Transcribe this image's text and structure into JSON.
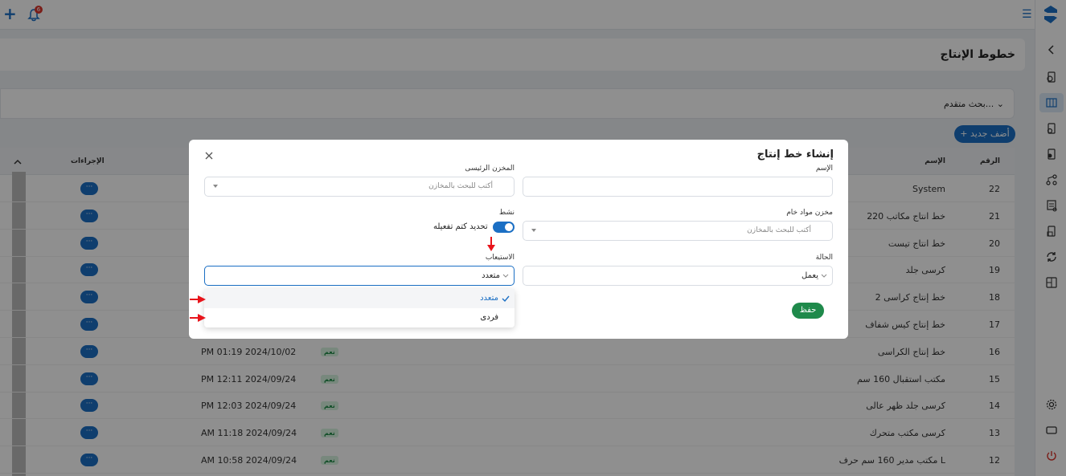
{
  "topbar": {
    "notification_count": "6"
  },
  "page": {
    "title": "خطوط الإنتاج",
    "search_toggle": "بحث متقدم...",
    "add_button": "+ أضف جديد"
  },
  "table": {
    "headers": {
      "number": "الرقم",
      "name": "الإسم",
      "actions": "الإجراءات"
    },
    "rows": [
      {
        "number": "22",
        "name": "System",
        "date": "",
        "badge": ""
      },
      {
        "number": "21",
        "name": "خط انتاج مكاتب 220",
        "date": "",
        "badge": ""
      },
      {
        "number": "20",
        "name": "خط انتاج تيست",
        "date": "",
        "badge": ""
      },
      {
        "number": "19",
        "name": "كرسى جلد",
        "date": "",
        "badge": ""
      },
      {
        "number": "18",
        "name": "خط إنتاج كراسى 2",
        "date": "",
        "badge": ""
      },
      {
        "number": "17",
        "name": "خط إنتاج كيس شفاف",
        "date": "",
        "badge": ""
      },
      {
        "number": "16",
        "name": "خط إنتاج الكراسى",
        "date": "PM 01:19 2024/10/02",
        "badge": "نعم"
      },
      {
        "number": "15",
        "name": "مكتب استقبال 160 سم",
        "date": "PM 12:11 2024/09/24",
        "badge": "نعم"
      },
      {
        "number": "14",
        "name": "كرسى جلد ظهر عالى",
        "date": "PM 12:03 2024/09/24",
        "badge": "نعم"
      },
      {
        "number": "13",
        "name": "كرسى مكتب متحرك",
        "date": "AM 11:18 2024/09/24",
        "badge": "نعم"
      },
      {
        "number": "12",
        "name": "مكتب مدير 160 سم حرف L",
        "date": "AM 10:58 2024/09/24",
        "badge": "نعم"
      }
    ],
    "actions_label": "···"
  },
  "modal": {
    "title": "إنشاء خط إنتاج",
    "name_label": "الإسم",
    "main_store_label": "المخزن الرئيسى",
    "main_store_placeholder": "أكتب للبحث بالمخازن",
    "raw_store_label": "مخزن مواد خام",
    "raw_store_placeholder": "أكتب للبحث بالمخازن",
    "active_label": "نشط",
    "toggle_text": "تحديد كتم تفعيله",
    "capacity_label": "الاستيعاب",
    "capacity_value": "متعدد",
    "status_label": "الحالة",
    "status_value": "يعمل",
    "dropdown_options": [
      "متعدد",
      "فردى"
    ],
    "save_button": "حفظ"
  },
  "colors": {
    "primary": "#1b6fc4",
    "success": "#1f8a4b",
    "annotation_arrow": "#e8141b"
  }
}
